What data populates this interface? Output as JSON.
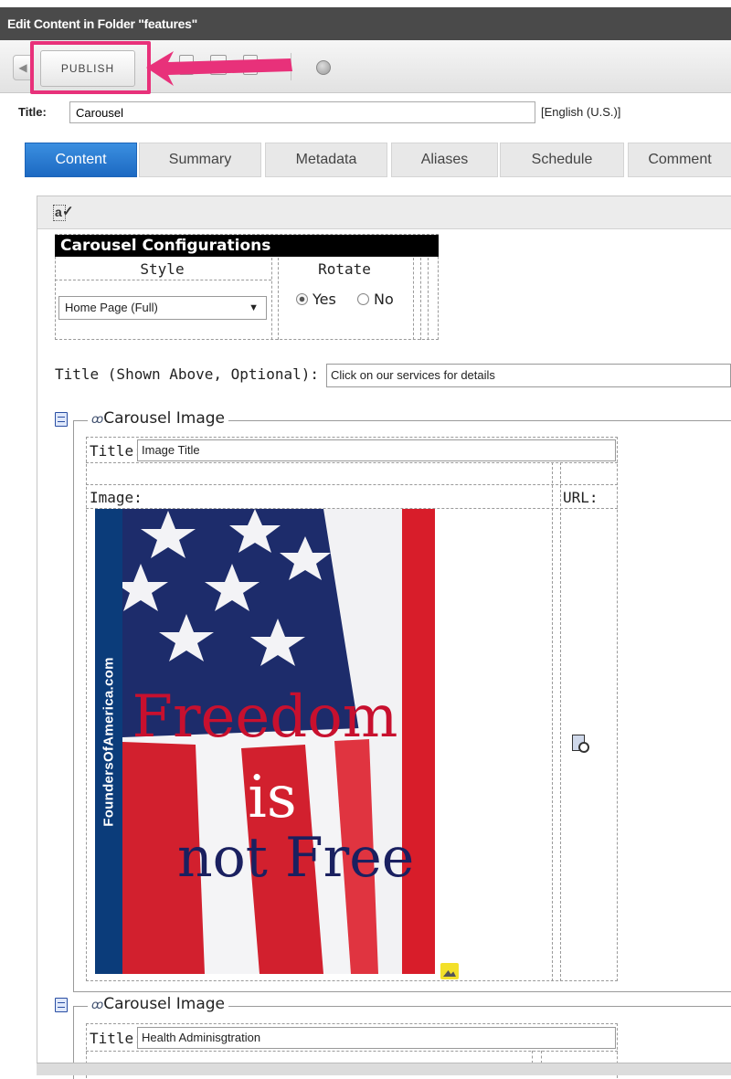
{
  "window": {
    "title": "Edit Content in Folder \"features\""
  },
  "toolbar": {
    "publish_label": "PUBLISH"
  },
  "content_title": {
    "label": "Title:",
    "value": "Carousel",
    "language": "[English (U.S.)]"
  },
  "tabs": [
    {
      "label": "Content",
      "active": true
    },
    {
      "label": "Summary"
    },
    {
      "label": "Metadata"
    },
    {
      "label": "Aliases"
    },
    {
      "label": "Schedule"
    },
    {
      "label": "Comment"
    }
  ],
  "config": {
    "header": "Carousel Configurations",
    "style_label": "Style",
    "rotate_label": "Rotate",
    "style_value": "Home Page (Full)",
    "rotate_yes": "Yes",
    "rotate_no": "No",
    "rotate_selected": "Yes"
  },
  "carousel_title": {
    "label": "Title (Shown Above, Optional):",
    "value": "Click on our services for details"
  },
  "carousel_items": [
    {
      "legend": "Carousel Image",
      "title_label": "Title:",
      "title_value": "Image Title",
      "image_label": "Image:",
      "url_label": "URL:",
      "poster": {
        "line1": "Freedom",
        "line2": "is",
        "line3_a": "not",
        "line3_b": "Free",
        "brand": "FoundersOfAmerica.com"
      }
    },
    {
      "legend": "Carousel Image",
      "title_label": "Title:",
      "title_value": "Health Adminisgtration"
    }
  ],
  "colors": {
    "highlight": "#e8317a",
    "active_tab": "#1c69c2",
    "poster_red": "#c8102e",
    "poster_navy": "#1a2060"
  },
  "icons": [
    "back-arrow-icon",
    "help-icon",
    "edit-mode-icon",
    "list-icon",
    "glasses-icon",
    "select-resource-icon",
    "insert-image-icon"
  ]
}
